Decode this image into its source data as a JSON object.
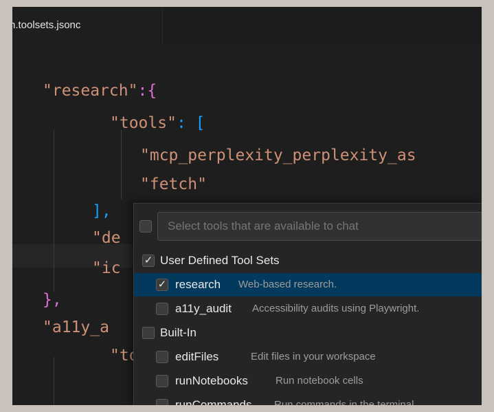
{
  "tab": {
    "filename": "h.toolsets.jsonc"
  },
  "code": {
    "line1_key": "\"research\"",
    "line1_rest": ":{",
    "line2_key": "\"tools\"",
    "line2_rest": ": [",
    "line3_str": "\"mcp_perplexity_perplexity_as",
    "line4_str": "\"fetch\"",
    "line5": "],",
    "line6_key": "\"de",
    "line7_key": "\"ic",
    "line8": "},",
    "line9_key": "\"a11y_a",
    "line10_key": "\"to"
  },
  "picker": {
    "search_placeholder": "Select tools that are available to chat",
    "groups": [
      {
        "label": "User Defined Tool Sets",
        "checked": true
      },
      {
        "label": "Built-In",
        "checked": false
      }
    ],
    "items": [
      {
        "name": "research",
        "desc": "Web-based research.",
        "checked": true
      },
      {
        "name": "a11y_audit",
        "desc": "Accessibility audits using Playwright.",
        "checked": false
      },
      {
        "name": "editFiles",
        "desc": "Edit files in your workspace",
        "checked": false
      },
      {
        "name": "runNotebooks",
        "desc": "Run notebook cells",
        "checked": false
      },
      {
        "name": "runCommands",
        "desc": "Run commands in the terminal",
        "checked": false
      }
    ],
    "check_glyph": "✓"
  },
  "colors": {
    "selection": "#04395e",
    "string": "#ce9178",
    "brace": "#da70d6",
    "bracket": "#179fff"
  }
}
